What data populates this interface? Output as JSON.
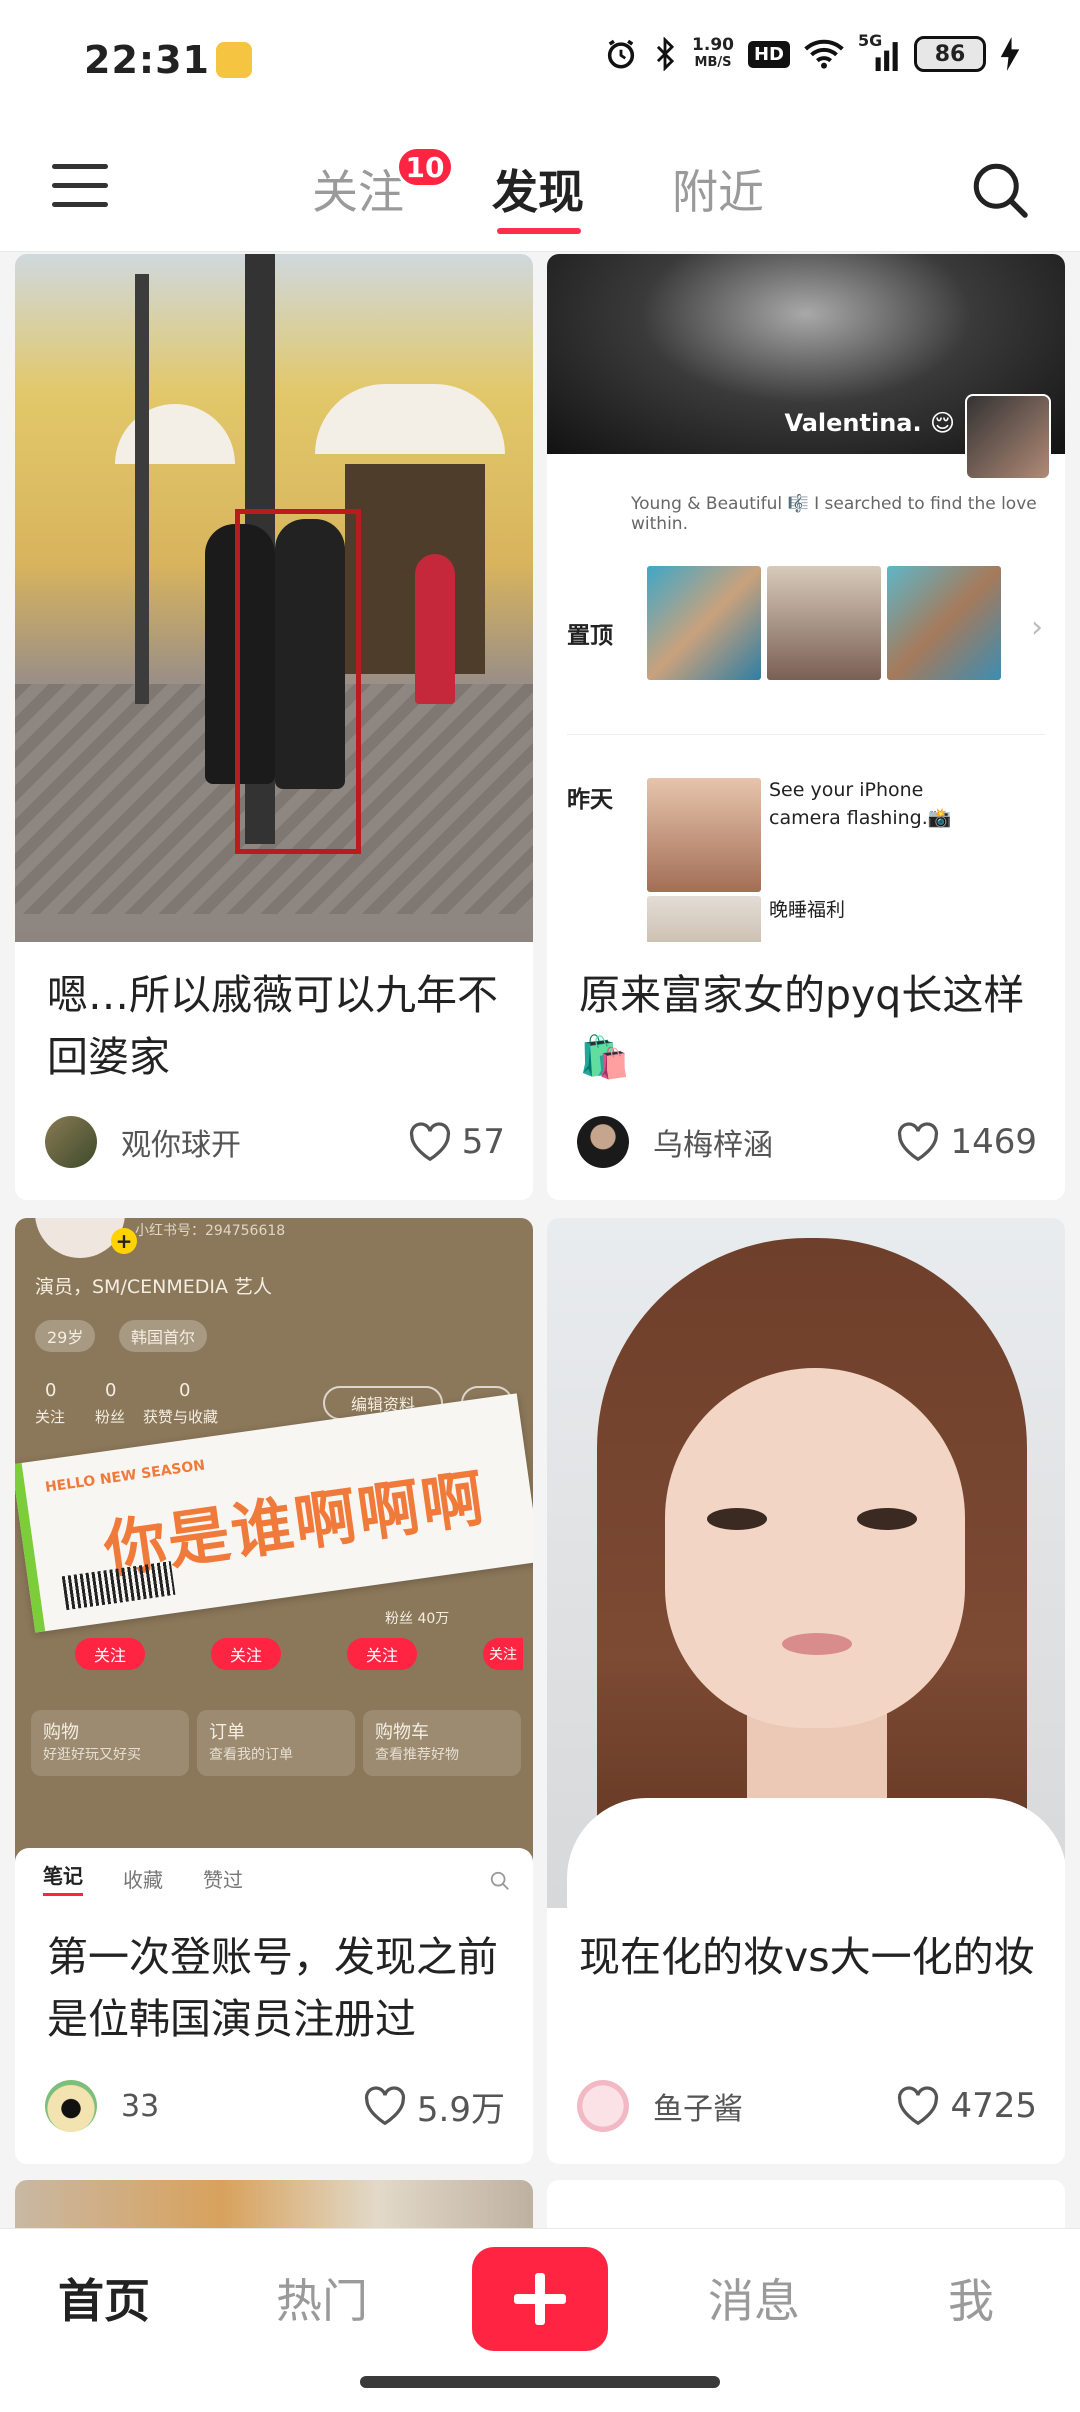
{
  "status_bar": {
    "time": "22:31",
    "speed_value": "1.90",
    "speed_unit": "MB/S",
    "hd_label": "HD",
    "network": "5G",
    "battery": "86",
    "icons": [
      "note-icon",
      "alarm-icon",
      "bluetooth-icon",
      "wifi-icon",
      "signal-icon",
      "battery-icon",
      "charging-icon"
    ]
  },
  "top_nav": {
    "tabs": [
      {
        "label": "关注",
        "badge": "10"
      },
      {
        "label": "发现",
        "active": true
      },
      {
        "label": "附近"
      }
    ],
    "icons": [
      "menu-icon",
      "search-icon"
    ],
    "accent_color": "#ff2442"
  },
  "feed": [
    {
      "title": "嗯…所以戚薇可以九年不回婆家",
      "author": "观你球开",
      "likes": "57"
    },
    {
      "title": "原来富家女的pyq长这样🛍️",
      "author": "乌梅梓涵",
      "likes": "1469",
      "image_text": {
        "name": "Valentina. 😌",
        "bio": "Young & Beautiful 🎼 I searched to find the love within.",
        "pinned_label": "置顶",
        "yesterday_label": "昨天",
        "post1": "See your iPhone camera flashing.📸",
        "post2": "晚睡福利"
      }
    },
    {
      "title": "第一次登账号，发现之前是位韩国演员注册过",
      "author": "33",
      "likes": "5.9万",
      "image_text": {
        "id_line": "小红书号：294756618",
        "profile_line": "演员，SM/CENMEDIA 艺人",
        "age_pill": "29岁",
        "region_pill": "韩国首尔",
        "stats": [
          {
            "num": "0",
            "label": "关注"
          },
          {
            "num": "0",
            "label": "粉丝"
          },
          {
            "num": "0",
            "label": "获赞与收藏"
          }
        ],
        "edit_button": "编辑资料",
        "ticket_small": "HELLO NEW SEASON",
        "ticket_text": "你是谁啊啊啊",
        "follow_label": "关注",
        "fans_text": "粉丝 40万",
        "boxes": [
          {
            "title": "购物",
            "sub": "好逛好玩又好买"
          },
          {
            "title": "订单",
            "sub": "查看我的订单"
          },
          {
            "title": "购物车",
            "sub": "查看推荐好物"
          }
        ],
        "tabs": [
          "笔记",
          "收藏",
          "赞过"
        ]
      }
    },
    {
      "title": "现在化的妆vs大一化的妆",
      "author": "鱼子酱",
      "likes": "4725"
    }
  ],
  "bottom_nav": {
    "items": [
      "首页",
      "热门",
      "消息",
      "我"
    ],
    "active": "首页",
    "publish_icon": "plus-icon"
  }
}
